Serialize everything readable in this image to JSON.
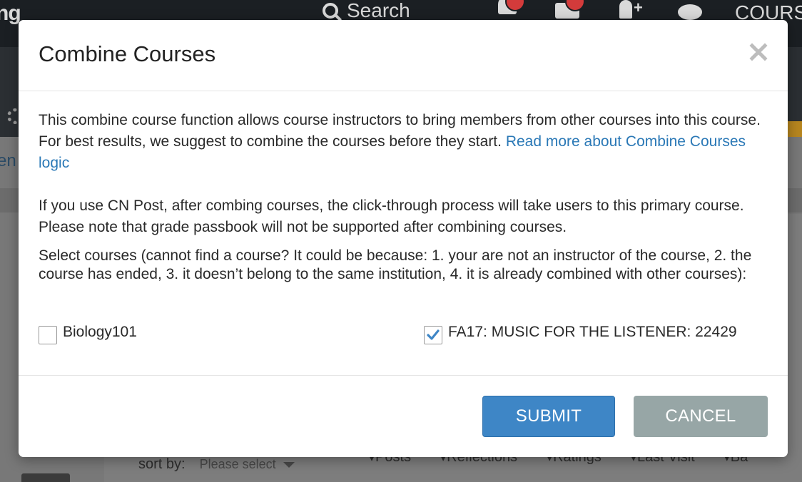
{
  "background": {
    "brand_fragment": "ng",
    "search_label": "Search",
    "courses_label": "COURS",
    "side_fragment": "en",
    "side_link_fragment": "o",
    "sort_label": "sort by:",
    "sort_placeholder": "Please select",
    "columns": [
      "Posts",
      "Reflections",
      "Ratings",
      "Last Visit",
      "Ba"
    ],
    "icons": [
      "search-icon",
      "bell-icon",
      "mail-icon",
      "add-user-icon",
      "chat-icon",
      "gear-icon"
    ]
  },
  "modal": {
    "title": "Combine Courses",
    "close_icon": "close-icon",
    "intro_text": "This combine course function allows course instructors to bring members from other courses into this course. For best results, we suggest to combine the courses before they start. ",
    "intro_link": "Read more about Combine Courses logic",
    "post_note": "If you use CN Post, after combing courses, the click-through process will take users to this primary course. Please note that grade passbook will not be supported after combining courses.",
    "select_instructions": "Select courses (cannot find a course? It could be because: 1. your are not an instructor of the course, 2. the course has ended, 3. it doesn’t belong to the same institution, 4. it is already combined with other courses):",
    "courses": [
      {
        "label": "Biology101",
        "checked": false
      },
      {
        "label": "FA17: MUSIC FOR THE LISTENER: 22429",
        "checked": true
      }
    ],
    "submit_label": "SUBMIT",
    "cancel_label": "CANCEL"
  },
  "colors": {
    "primary": "#3e86c6",
    "secondary": "#97a6a6",
    "link": "#2a78b6",
    "checkmark": "#3e86c6",
    "notification_badge": "#d33b3b"
  }
}
